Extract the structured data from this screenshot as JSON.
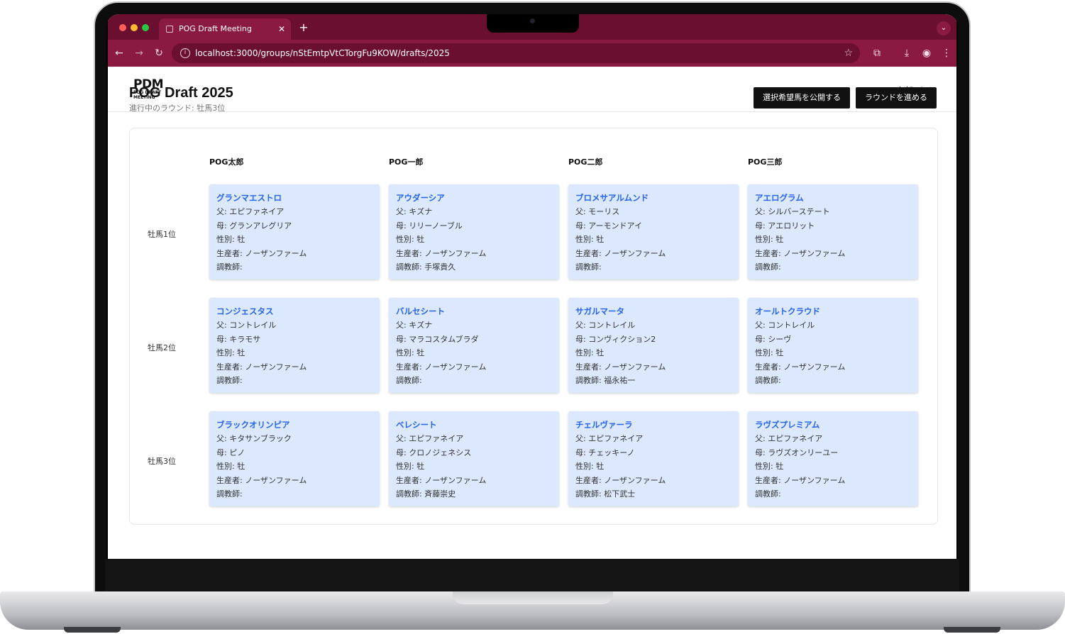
{
  "browser": {
    "tab_title": "POG Draft Meeting",
    "url": "localhost:3000/groups/nStEmtpVtCTorgFu9KOW/drafts/2025",
    "colors": {
      "frame": "#6a0f2f",
      "toolbar": "#8a1a42"
    }
  },
  "header": {
    "logo_main": "PDM",
    "logo_sub": "POG DRAFT MEETING",
    "user": "POG太郎 さん"
  },
  "page": {
    "title": "POG Draft 2025",
    "status": "進行中のラウンド: 牡馬3位",
    "publish_button": "選択希望馬を公開する",
    "advance_button": "ラウンドを進める"
  },
  "board": {
    "players": [
      "POG太郎",
      "POG一郎",
      "POG二郎",
      "POG三郎"
    ],
    "rounds": [
      {
        "label": "牡馬1位",
        "picks": [
          {
            "name": "グランマエストロ",
            "sire": "父: エピファネイア",
            "dam": "母: グランアレグリア",
            "sex": "性別: 牡",
            "breeder": "生産者: ノーザンファーム",
            "trainer": "調教師:"
          },
          {
            "name": "アウダーシア",
            "sire": "父: キズナ",
            "dam": "母: リリーノーブル",
            "sex": "性別: 牡",
            "breeder": "生産者: ノーザンファーム",
            "trainer": "調教師: 手塚貴久"
          },
          {
            "name": "ブロメサアルムンド",
            "sire": "父: モーリス",
            "dam": "母: アーモンドアイ",
            "sex": "性別: 牡",
            "breeder": "生産者: ノーザンファーム",
            "trainer": "調教師:"
          },
          {
            "name": "アエログラム",
            "sire": "父: シルバーステート",
            "dam": "母: アエロリット",
            "sex": "性別: 牡",
            "breeder": "生産者: ノーザンファーム",
            "trainer": "調教師:"
          }
        ]
      },
      {
        "label": "牡馬2位",
        "picks": [
          {
            "name": "コンジェスタス",
            "sire": "父: コントレイル",
            "dam": "母: キラモサ",
            "sex": "性別: 牡",
            "breeder": "生産者: ノーザンファーム",
            "trainer": "調教師:"
          },
          {
            "name": "バルセシート",
            "sire": "父: キズナ",
            "dam": "母: マラコスタムブラダ",
            "sex": "性別: 牡",
            "breeder": "生産者: ノーザンファーム",
            "trainer": "調教師:"
          },
          {
            "name": "サガルマータ",
            "sire": "父: コントレイル",
            "dam": "母: コンヴィクション2",
            "sex": "性別: 牡",
            "breeder": "生産者: ノーザンファーム",
            "trainer": "調教師: 福永祐一"
          },
          {
            "name": "オールトクラウド",
            "sire": "父: コントレイル",
            "dam": "母: シーヴ",
            "sex": "性別: 牡",
            "breeder": "生産者: ノーザンファーム",
            "trainer": "調教師:"
          }
        ]
      },
      {
        "label": "牡馬3位",
        "picks": [
          {
            "name": "ブラックオリンピア",
            "sire": "父: キタサンブラック",
            "dam": "母: ピノ",
            "sex": "性別: 牡",
            "breeder": "生産者: ノーザンファーム",
            "trainer": "調教師:"
          },
          {
            "name": "ベレシート",
            "sire": "父: エピファネイア",
            "dam": "母: クロノジェネシス",
            "sex": "性別: 牡",
            "breeder": "生産者: ノーザンファーム",
            "trainer": "調教師: 斉藤崇史"
          },
          {
            "name": "チェルヴァーラ",
            "sire": "父: エピファネイア",
            "dam": "母: チェッキーノ",
            "sex": "性別: 牡",
            "breeder": "生産者: ノーザンファーム",
            "trainer": "調教師: 松下武士"
          },
          {
            "name": "ラヴズプレミアム",
            "sire": "父: エピファネイア",
            "dam": "母: ラヴズオンリーユー",
            "sex": "性別: 牡",
            "breeder": "生産者: ノーザンファーム",
            "trainer": "調教師:"
          }
        ]
      }
    ]
  }
}
